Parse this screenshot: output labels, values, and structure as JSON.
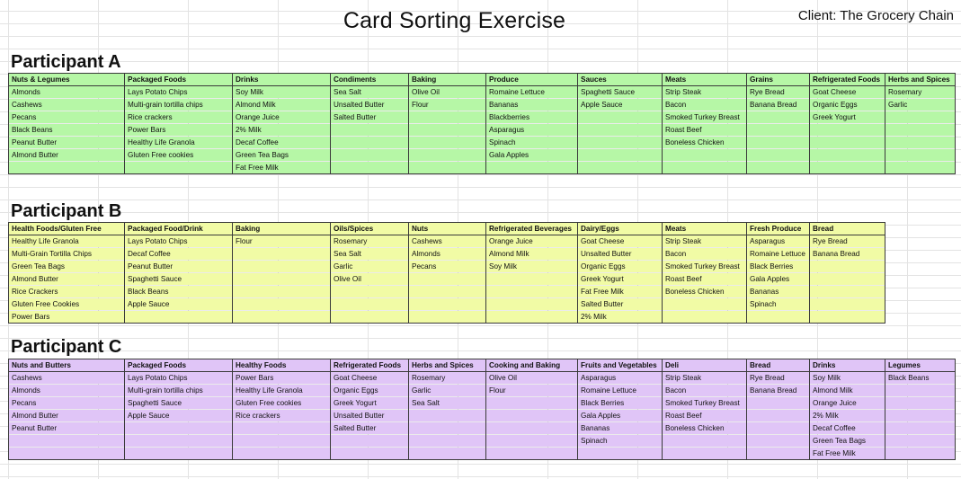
{
  "title": "Card Sorting Exercise",
  "client": "Client: The Grocery Chain",
  "colors": {
    "a_fill": "#b6f7a6",
    "b_fill": "#f1fba5",
    "c_fill": "#e0c5f7"
  },
  "participants": [
    {
      "label": "Participant A",
      "headers": [
        "Nuts & Legumes",
        "Packaged Foods",
        "Drinks",
        "Condiments",
        "Baking",
        "Produce",
        "Sauces",
        "Meats",
        "Grains",
        "Refrigerated Foods",
        "Herbs and Spices"
      ],
      "rows": [
        [
          "Almonds",
          "Lays Potato Chips",
          "Soy Milk",
          "Sea Salt",
          "Olive Oil",
          "Romaine Lettuce",
          "Spaghetti Sauce",
          "Strip Steak",
          "Rye Bread",
          "Goat Cheese",
          "Rosemary"
        ],
        [
          "Cashews",
          "Multi-grain tortilla chips",
          "Almond Milk",
          "Unsalted Butter",
          "Flour",
          "Bananas",
          "Apple Sauce",
          "Bacon",
          "Banana Bread",
          "Organic Eggs",
          "Garlic"
        ],
        [
          "Pecans",
          "Rice crackers",
          "Orange Juice",
          "Salted Butter",
          "",
          "Blackberries",
          "",
          "Smoked Turkey Breast",
          "",
          "Greek Yogurt",
          ""
        ],
        [
          "Black Beans",
          "Power Bars",
          "2% Milk",
          "",
          "",
          "Asparagus",
          "",
          "Roast Beef",
          "",
          "",
          ""
        ],
        [
          "Peanut Butter",
          "Healthy Life Granola",
          "Decaf Coffee",
          "",
          "",
          "Spinach",
          "",
          "Boneless Chicken",
          "",
          "",
          ""
        ],
        [
          "Almond Butter",
          "Gluten Free cookies",
          "Green Tea Bags",
          "",
          "",
          "Gala Apples",
          "",
          "",
          "",
          "",
          ""
        ],
        [
          "",
          "",
          "Fat Free Milk",
          "",
          "",
          "",
          "",
          "",
          "",
          "",
          ""
        ]
      ]
    },
    {
      "label": "Participant B",
      "headers": [
        "Health Foods/Gluten Free",
        "Packaged Food/Drink",
        "Baking",
        "Oils/Spices",
        "Nuts",
        "Refrigerated Beverages",
        "Dairy/Eggs",
        "Meats",
        "Fresh Produce",
        "Bread"
      ],
      "rows": [
        [
          "Healthy Life Granola",
          "Lays Potato Chips",
          "Flour",
          "Rosemary",
          "Cashews",
          "Orange Juice",
          "Goat Cheese",
          "Strip Steak",
          "Asparagus",
          "Rye Bread"
        ],
        [
          "Multi-Grain Tortilla Chips",
          "Decaf Coffee",
          "",
          "Sea Salt",
          "Almonds",
          "Almond Milk",
          "Unsalted Butter",
          "Bacon",
          "Romaine Lettuce",
          "Banana Bread"
        ],
        [
          "Green Tea Bags",
          "Peanut Butter",
          "",
          "Garlic",
          "Pecans",
          "Soy Milk",
          "Organic Eggs",
          "Smoked Turkey Breast",
          "Black Berries",
          ""
        ],
        [
          "Almond Butter",
          "Spaghetti Sauce",
          "",
          "Olive Oil",
          "",
          "",
          "Greek Yogurt",
          "Roast Beef",
          "Gala Apples",
          ""
        ],
        [
          "Rice Crackers",
          "Black Beans",
          "",
          "",
          "",
          "",
          "Fat Free Milk",
          "Boneless Chicken",
          "Bananas",
          ""
        ],
        [
          "Gluten Free Cookies",
          "Apple Sauce",
          "",
          "",
          "",
          "",
          "Salted Butter",
          "",
          "Spinach",
          ""
        ],
        [
          "Power Bars",
          "",
          "",
          "",
          "",
          "",
          "2% Milk",
          "",
          "",
          ""
        ]
      ]
    },
    {
      "label": "Participant C",
      "headers": [
        "Nuts and Butters",
        "Packaged Foods",
        "Healthy Foods",
        "Refrigerated Foods",
        "Herbs and Spices",
        "Cooking and Baking",
        "Fruits and Vegetables",
        "Deli",
        "Bread",
        "Drinks",
        "Legumes"
      ],
      "rows": [
        [
          "Cashews",
          "Lays Potato Chips",
          "Power Bars",
          "Goat Cheese",
          "Rosemary",
          "Olive Oil",
          "Asparagus",
          "Strip Steak",
          "Rye Bread",
          "Soy Milk",
          "Black Beans"
        ],
        [
          "Almonds",
          "Multi-grain tortilla chips",
          "Healthy Life Granola",
          "Organic Eggs",
          "Garlic",
          "Flour",
          "Romaine Lettuce",
          "Bacon",
          "Banana Bread",
          "Almond Milk",
          ""
        ],
        [
          "Pecans",
          "Spaghetti Sauce",
          "Gluten Free cookies",
          "Greek Yogurt",
          "Sea Salt",
          "",
          "Black Berries",
          "Smoked Turkey Breast",
          "",
          "Orange Juice",
          ""
        ],
        [
          "Almond Butter",
          "Apple Sauce",
          "Rice crackers",
          "Unsalted Butter",
          "",
          "",
          "Gala Apples",
          "Roast Beef",
          "",
          "2% Milk",
          ""
        ],
        [
          "Peanut Butter",
          "",
          "",
          "Salted Butter",
          "",
          "",
          "Bananas",
          "Boneless Chicken",
          "",
          "Decaf Coffee",
          ""
        ],
        [
          "",
          "",
          "",
          "",
          "",
          "",
          "Spinach",
          "",
          "",
          "Green Tea Bags",
          ""
        ],
        [
          "",
          "",
          "",
          "",
          "",
          "",
          "",
          "",
          "",
          "Fat Free Milk",
          ""
        ]
      ]
    }
  ]
}
